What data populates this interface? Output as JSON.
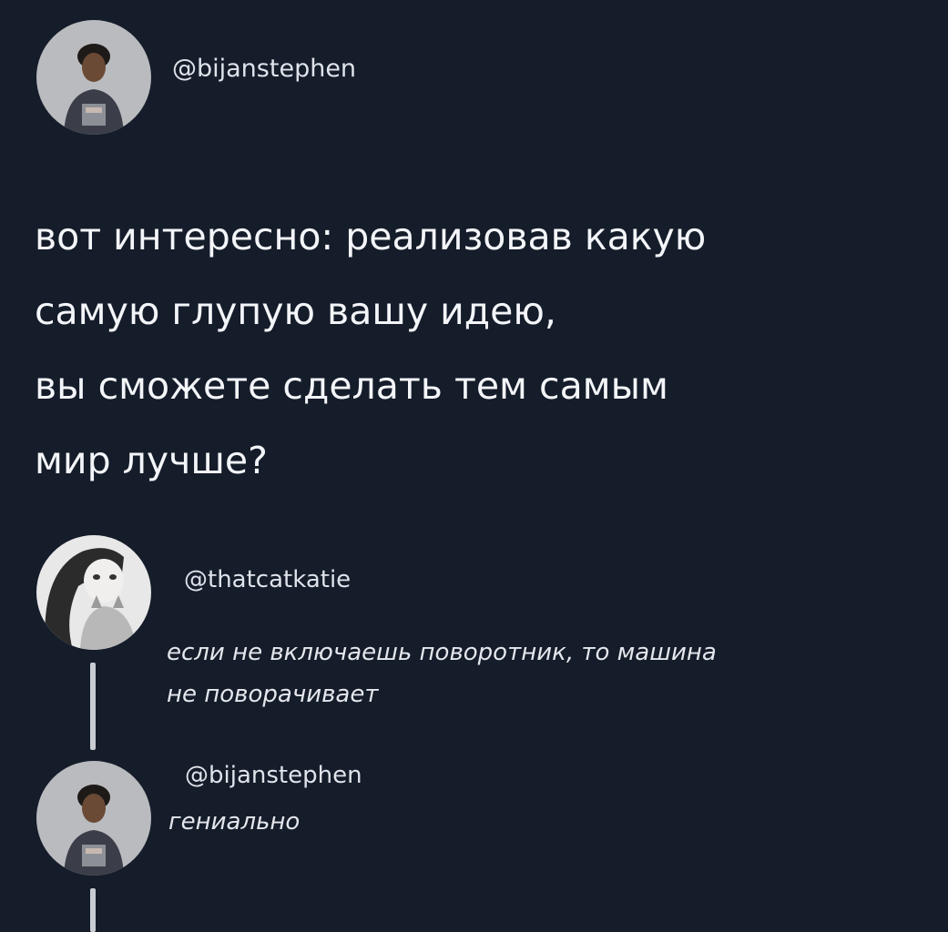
{
  "post": {
    "author": "@bijanstephen",
    "text_lines": [
      "вот интересно: реализовав какую",
      "самую глупую вашу идею,",
      "вы сможете сделать тем самым",
      "мир лучше?"
    ]
  },
  "replies": [
    {
      "author": "@thatcatkatie",
      "text_lines": [
        "если не включаешь поворотник, то машина",
        "не поворачивает"
      ]
    },
    {
      "author": "@bijanstephen",
      "text_lines": [
        "гениально"
      ]
    }
  ]
}
